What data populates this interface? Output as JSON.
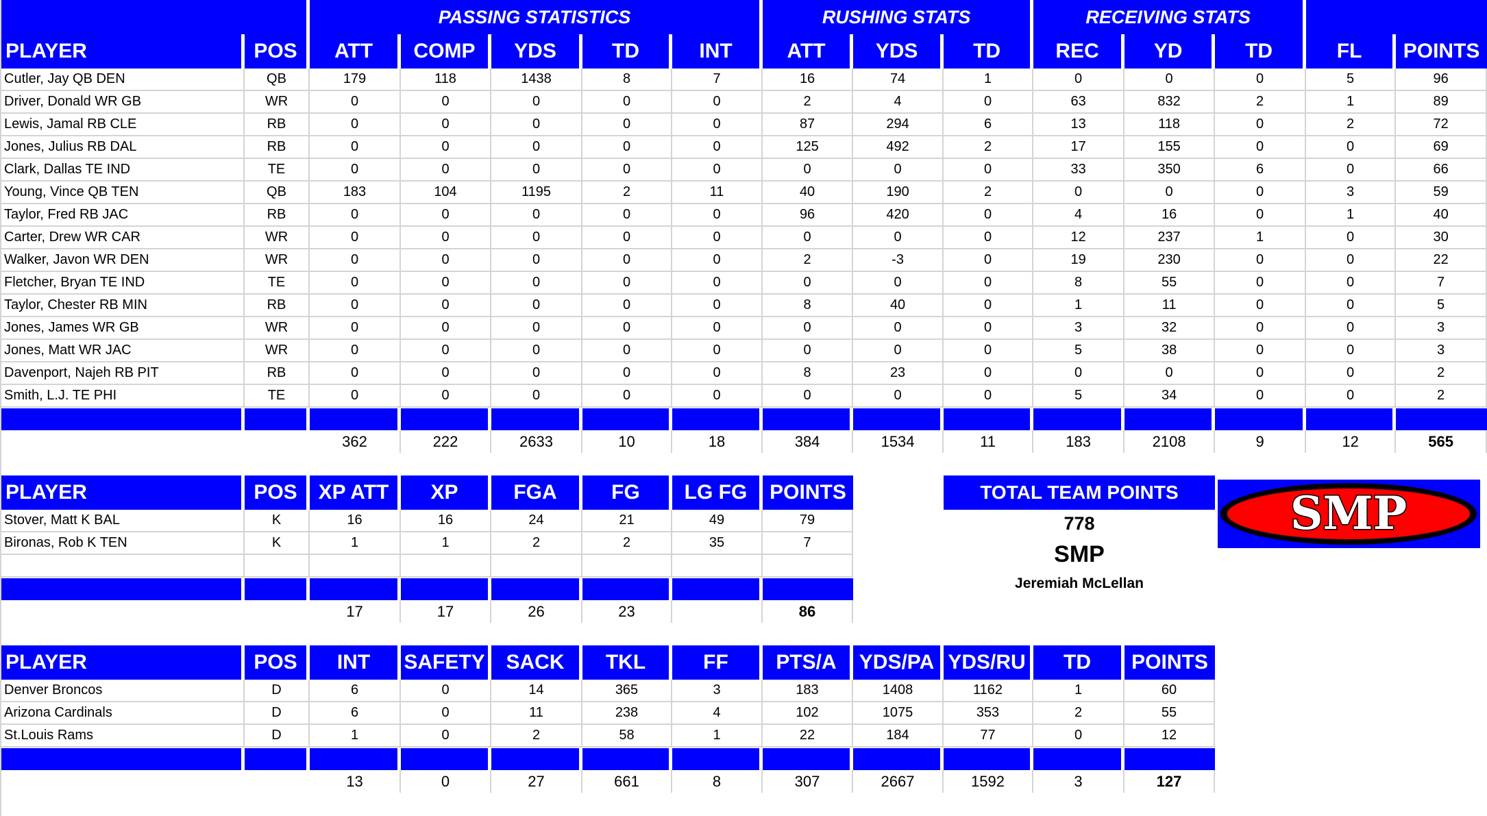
{
  "offense": {
    "groups": [
      {
        "label": "",
        "span": 2
      },
      {
        "label": "PASSING STATISTICS",
        "span": 5
      },
      {
        "label": "RUSHING STATS",
        "span": 3
      },
      {
        "label": "RECEIVING STATS",
        "span": 3
      },
      {
        "label": "",
        "span": 2
      }
    ],
    "columns": [
      "PLAYER",
      "POS",
      "ATT",
      "COMP",
      "YDS",
      "TD",
      "INT",
      "ATT",
      "YDS",
      "TD",
      "REC",
      "YD",
      "TD",
      "FL",
      "POINTS"
    ],
    "rows": [
      [
        "Cutler, Jay QB DEN",
        "QB",
        "179",
        "118",
        "1438",
        "8",
        "7",
        "16",
        "74",
        "1",
        "0",
        "0",
        "0",
        "5",
        "96"
      ],
      [
        "Driver, Donald WR GB",
        "WR",
        "0",
        "0",
        "0",
        "0",
        "0",
        "2",
        "4",
        "0",
        "63",
        "832",
        "2",
        "1",
        "89"
      ],
      [
        "Lewis, Jamal RB CLE",
        "RB",
        "0",
        "0",
        "0",
        "0",
        "0",
        "87",
        "294",
        "6",
        "13",
        "118",
        "0",
        "2",
        "72"
      ],
      [
        "Jones, Julius RB DAL",
        "RB",
        "0",
        "0",
        "0",
        "0",
        "0",
        "125",
        "492",
        "2",
        "17",
        "155",
        "0",
        "0",
        "69"
      ],
      [
        "Clark, Dallas TE IND",
        "TE",
        "0",
        "0",
        "0",
        "0",
        "0",
        "0",
        "0",
        "0",
        "33",
        "350",
        "6",
        "0",
        "66"
      ],
      [
        "Young, Vince QB TEN",
        "QB",
        "183",
        "104",
        "1195",
        "2",
        "11",
        "40",
        "190",
        "2",
        "0",
        "0",
        "0",
        "3",
        "59"
      ],
      [
        "Taylor, Fred RB JAC",
        "RB",
        "0",
        "0",
        "0",
        "0",
        "0",
        "96",
        "420",
        "0",
        "4",
        "16",
        "0",
        "1",
        "40"
      ],
      [
        "Carter, Drew WR CAR",
        "WR",
        "0",
        "0",
        "0",
        "0",
        "0",
        "0",
        "0",
        "0",
        "12",
        "237",
        "1",
        "0",
        "30"
      ],
      [
        "Walker, Javon WR DEN",
        "WR",
        "0",
        "0",
        "0",
        "0",
        "0",
        "2",
        "-3",
        "0",
        "19",
        "230",
        "0",
        "0",
        "22"
      ],
      [
        "Fletcher, Bryan TE IND",
        "TE",
        "0",
        "0",
        "0",
        "0",
        "0",
        "0",
        "0",
        "0",
        "8",
        "55",
        "0",
        "0",
        "7"
      ],
      [
        "Taylor, Chester RB MIN",
        "RB",
        "0",
        "0",
        "0",
        "0",
        "0",
        "8",
        "40",
        "0",
        "1",
        "11",
        "0",
        "0",
        "5"
      ],
      [
        "Jones, James WR GB",
        "WR",
        "0",
        "0",
        "0",
        "0",
        "0",
        "0",
        "0",
        "0",
        "3",
        "32",
        "0",
        "0",
        "3"
      ],
      [
        "Jones, Matt WR JAC",
        "WR",
        "0",
        "0",
        "0",
        "0",
        "0",
        "0",
        "0",
        "0",
        "5",
        "38",
        "0",
        "0",
        "3"
      ],
      [
        "Davenport, Najeh RB PIT",
        "RB",
        "0",
        "0",
        "0",
        "0",
        "0",
        "8",
        "23",
        "0",
        "0",
        "0",
        "0",
        "0",
        "2"
      ],
      [
        "Smith, L.J. TE PHI",
        "TE",
        "0",
        "0",
        "0",
        "0",
        "0",
        "0",
        "0",
        "0",
        "5",
        "34",
        "0",
        "0",
        "2"
      ]
    ],
    "totals": [
      "",
      "",
      "362",
      "222",
      "2633",
      "10",
      "18",
      "384",
      "1534",
      "11",
      "183",
      "2108",
      "9",
      "12",
      "565"
    ]
  },
  "kickers": {
    "columns": [
      "PLAYER",
      "POS",
      "XP ATT",
      "XP",
      "FGA",
      "FG",
      "LG FG",
      "POINTS"
    ],
    "rows": [
      [
        "Stover, Matt K BAL",
        "K",
        "16",
        "16",
        "24",
        "21",
        "49",
        "79"
      ],
      [
        "Bironas, Rob K TEN",
        "K",
        "1",
        "1",
        "2",
        "2",
        "35",
        "7"
      ]
    ],
    "totals": [
      "",
      "",
      "17",
      "17",
      "26",
      "23",
      "",
      "86"
    ]
  },
  "defense": {
    "columns": [
      "PLAYER",
      "POS",
      "INT",
      "SAFETY",
      "SACK",
      "TKL",
      "FF",
      "PTS/A",
      "YDS/PA",
      "YDS/RU",
      "TD",
      "POINTS"
    ],
    "rows": [
      [
        "Denver Broncos",
        "D",
        "6",
        "0",
        "14",
        "365",
        "3",
        "183",
        "1408",
        "1162",
        "1",
        "60"
      ],
      [
        "Arizona Cardinals",
        "D",
        "6",
        "0",
        "11",
        "238",
        "4",
        "102",
        "1075",
        "353",
        "2",
        "55"
      ],
      [
        "St.Louis Rams",
        "D",
        "1",
        "0",
        "2",
        "58",
        "1",
        "22",
        "184",
        "77",
        "0",
        "12"
      ]
    ],
    "totals": [
      "",
      "",
      "13",
      "0",
      "27",
      "661",
      "8",
      "307",
      "2667",
      "1592",
      "3",
      "127"
    ]
  },
  "team": {
    "title": "TOTAL TEAM POINTS",
    "points": "778",
    "name": "SMP",
    "owner": "Jeremiah McLellan",
    "logo_text": "SMP",
    "logo_icon": "smp-logo-oval",
    "colors": {
      "header_blue": "#0000ff",
      "logo_red": "#ff0000",
      "logo_black": "#000000"
    }
  }
}
